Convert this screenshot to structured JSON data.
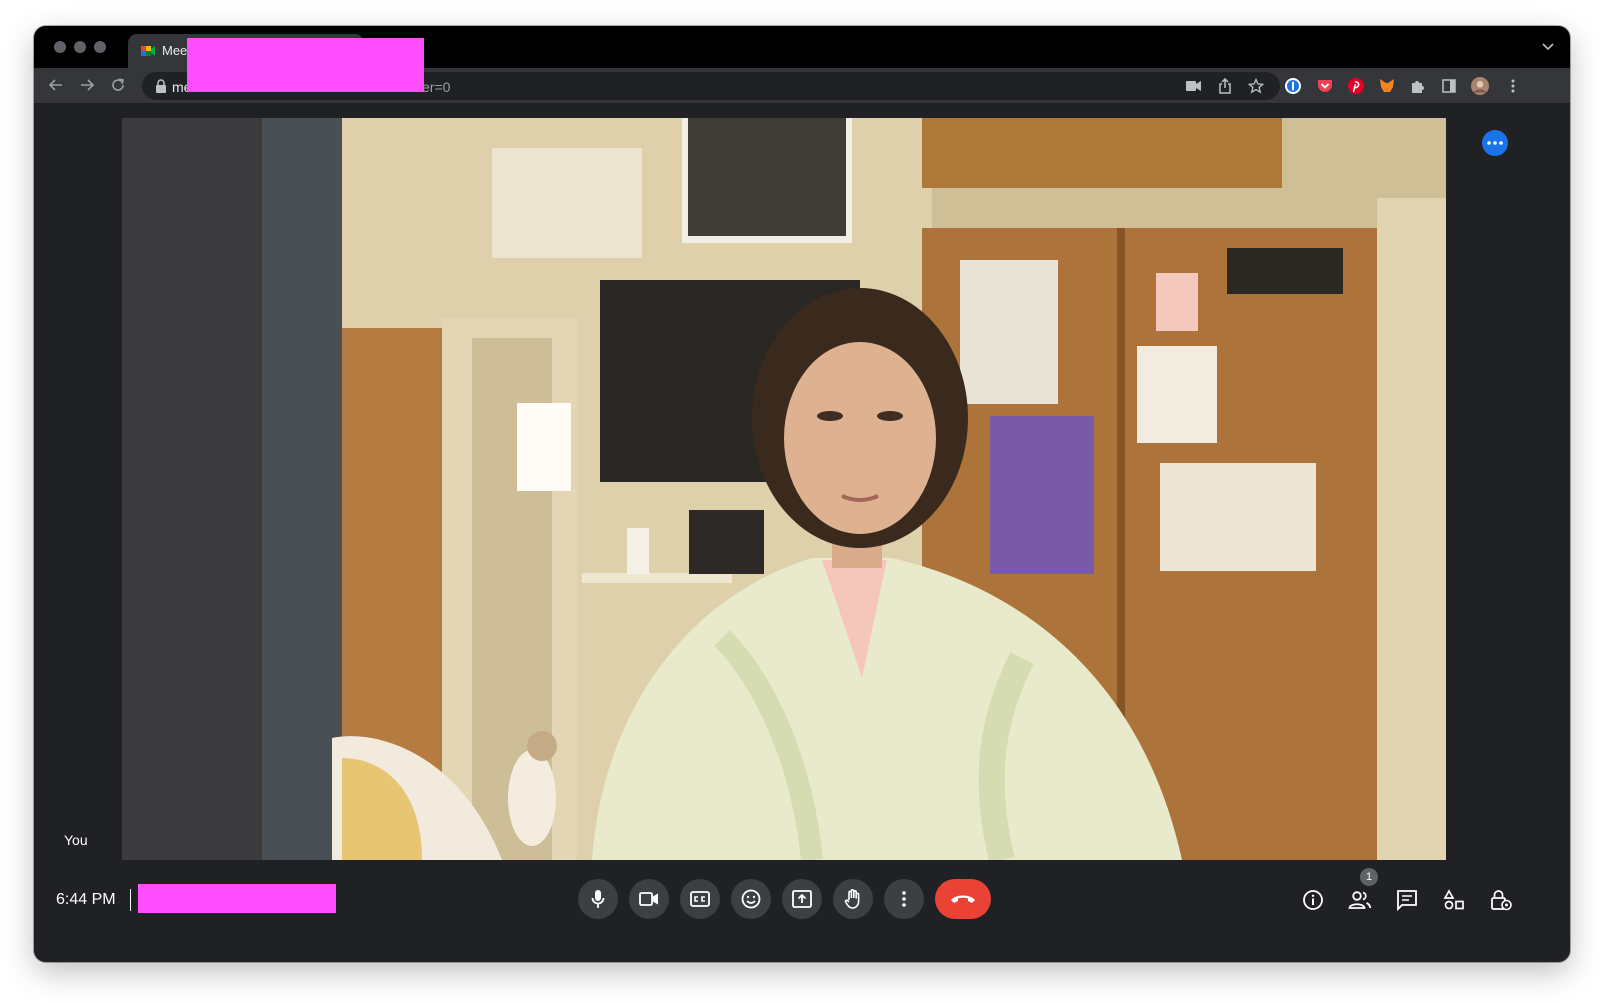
{
  "browser": {
    "tab_title": "Meet",
    "url_visible_start": "me",
    "url_visible_end": "er=0"
  },
  "meeting": {
    "self_label": "You",
    "time": "6:44 PM",
    "participants_badge": "1"
  },
  "icons": {
    "controls": [
      "microphone-icon",
      "camera-icon",
      "captions-icon",
      "emoji-icon",
      "present-icon",
      "raise-hand-icon",
      "more-options-icon",
      "end-call-icon"
    ],
    "side": [
      "info-icon",
      "people-icon",
      "chat-icon",
      "activities-icon",
      "host-controls-icon"
    ]
  },
  "colors": {
    "meet_background": "#202124",
    "control_button": "#3c4043",
    "end_call": "#ea4335",
    "accent_blue": "#1a73e8",
    "redaction": "#ff4dff"
  }
}
